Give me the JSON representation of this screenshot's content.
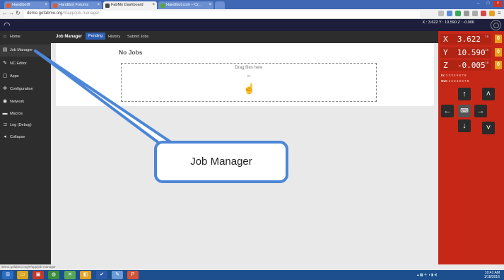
{
  "browser": {
    "tabs": [
      {
        "label": "Handibot®",
        "icon": "handibot-favicon-icon",
        "color": "#e05a2b"
      },
      {
        "label": "Handibot Forums",
        "icon": "forum-favicon-icon",
        "color": "#e05a2b"
      },
      {
        "label": "FabMo Dashboard",
        "icon": "fabmo-favicon-icon",
        "color": "#444444"
      },
      {
        "label": "Handibot.com – Cr...",
        "icon": "handibot-com-favicon-icon",
        "color": "#57a639"
      }
    ],
    "url_host": "demo.gofabmo.org",
    "url_path": "/#/app/job-manager",
    "window_controls": [
      "minimize-icon",
      "maximize-icon",
      "close-icon"
    ]
  },
  "header": {
    "coords": "X : 3.622   Y : 10.590   Z : -0.006"
  },
  "sidebar": {
    "items": [
      {
        "label": "Home",
        "icon": "home-icon"
      },
      {
        "label": "Job Manager",
        "icon": "job-manager-icon"
      },
      {
        "label": "NC Editor",
        "icon": "pencil-icon"
      },
      {
        "label": "Apps",
        "icon": "apps-icon"
      },
      {
        "label": "Configuration",
        "icon": "gear-icon"
      },
      {
        "label": "Network",
        "icon": "globe-icon"
      },
      {
        "label": "Macros",
        "icon": "folder-icon"
      },
      {
        "label": "Log (Debug)",
        "icon": "log-icon"
      },
      {
        "label": "Collapse",
        "icon": "collapse-icon"
      }
    ]
  },
  "topnav": {
    "brand": "Job Manager",
    "tabs": [
      "Pending",
      "History",
      "Submit Jobs"
    ]
  },
  "main": {
    "title": "No Jobs",
    "drop_text": "Drag files here",
    "or_text": "or"
  },
  "dro": {
    "x": {
      "label": "X",
      "value": "3.622",
      "unit": "in",
      "zero": "0"
    },
    "y": {
      "label": "Y",
      "value": "10.590",
      "unit": "in",
      "zero": "0"
    },
    "z": {
      "label": "Z",
      "value": "-0.005",
      "unit": "in",
      "zero": "0"
    },
    "in_label": "In:",
    "in_values": "1 2 3 4 5 6 7 8",
    "out_label": "Out:",
    "out_values": "1 2 3 4 5 6 7 8"
  },
  "status_url": "demo.gofabmo.org/#/app/job-manager",
  "taskbar": {
    "time": "10:41 AM",
    "date": "1/18/2016"
  },
  "callout": {
    "text": "Job Manager"
  }
}
